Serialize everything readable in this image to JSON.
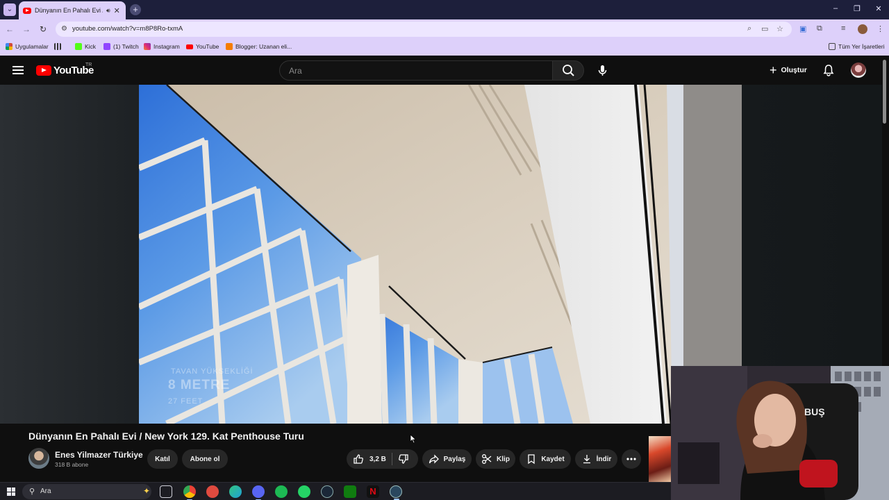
{
  "browser": {
    "tab_title": "Dünyanın En Pahalı Evi / Ne",
    "url": "youtube.com/watch?v=m8P8Ro-txmA",
    "bookmarks": [
      {
        "label": "Uygulamalar",
        "icon": "apps-grid-icon",
        "color": "#d14b3b"
      },
      {
        "label": "",
        "icon": "grid-icon",
        "color": "#333333"
      },
      {
        "label": "Kick",
        "icon": "kick-icon",
        "color": "#53fc18"
      },
      {
        "label": "(1) Twitch",
        "icon": "twitch-icon",
        "color": "#9146ff"
      },
      {
        "label": "Instagram",
        "icon": "instagram-icon",
        "color": "#dd2a7b"
      },
      {
        "label": "YouTube",
        "icon": "youtube-icon",
        "color": "#ff0000"
      },
      {
        "label": "Blogger: Uzanan eli...",
        "icon": "blogger-icon",
        "color": "#f57d00"
      }
    ],
    "all_bookmarks": "Tüm Yer İşaretleri"
  },
  "youtube": {
    "logo_text": "YouTube",
    "region": "TR",
    "search_placeholder": "Ara",
    "create_label": "Oluştur"
  },
  "video": {
    "overlay_line1": "TAVAN YÜKSEKLİĞİ",
    "overlay_line2": "8 METRE",
    "overlay_line3": "27 FEET",
    "title": "Dünyanın En Pahalı Evi / New York 129. Kat Penthouse Turu",
    "channel_name": "Enes Yilmazer Türkiye",
    "subscribers": "318 B abone",
    "join_label": "Katıl",
    "subscribe_label": "Abone ol",
    "likes": "3,2 B",
    "share_label": "Paylaş",
    "clip_label": "Klip",
    "save_label": "Kaydet",
    "download_label": "İndir"
  },
  "webcam": {
    "shirt_text": "BUŞ"
  },
  "taskbar": {
    "search_text": "Ara",
    "apps": [
      {
        "name": "task-view-icon",
        "color": "#3a3a44"
      },
      {
        "name": "chrome-icon",
        "color": "#4285f4"
      },
      {
        "name": "app-red-icon",
        "color": "#e04a3f"
      },
      {
        "name": "edge-icon",
        "color": "#1fa1d6"
      },
      {
        "name": "discord-icon",
        "color": "#5865f2"
      },
      {
        "name": "spotify-icon",
        "color": "#1db954"
      },
      {
        "name": "whatsapp-icon",
        "color": "#25d366"
      },
      {
        "name": "steam-icon",
        "color": "#1b2838"
      },
      {
        "name": "xbox-icon",
        "color": "#107c10"
      },
      {
        "name": "netflix-icon",
        "color": "#e50914"
      },
      {
        "name": "steam-alt-icon",
        "color": "#2a475e"
      }
    ]
  },
  "colors": {
    "browser_frame": "#1d1f3b",
    "browser_toolbar": "#ddd0fa",
    "youtube_bg": "#0f0f0f",
    "youtube_red": "#ff0000",
    "pill_bg": "#272727"
  }
}
